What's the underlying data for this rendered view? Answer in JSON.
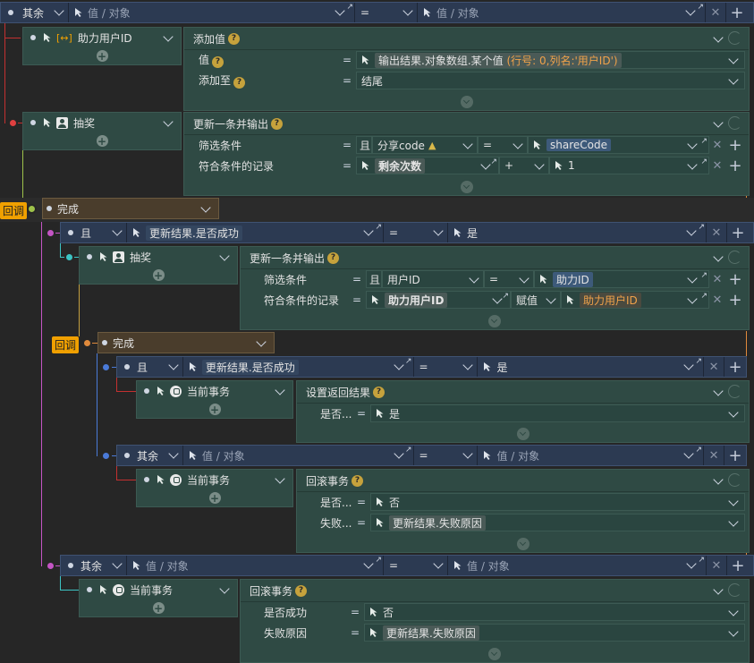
{
  "placeholder_value": "值 / 对象",
  "op_eq": "=",
  "callback": "回调",
  "done": "完成",
  "colors": {
    "cond_bg": "#2c3a52",
    "node_bg": "#2f4a44",
    "done_bg": "#4a3d2c",
    "accent_orange": "#f0a000"
  },
  "b1": {
    "keyword": "其余"
  },
  "n1": {
    "label": "助力用户ID",
    "icon": "variable-icon"
  },
  "p1": {
    "title": "添加值",
    "rows": [
      {
        "label": "值",
        "value_pre": "输出结果.对象数组.某个值",
        "value_hint": "(行号: 0,列名:'用户ID')"
      },
      {
        "label": "添加至",
        "value": "结尾"
      }
    ]
  },
  "n2": {
    "label": "抽奖",
    "icon": "person-icon"
  },
  "p2": {
    "title": "更新一条并输出",
    "rows": [
      {
        "label": "筛选条件",
        "and": "且",
        "field": "分享code",
        "op": "=",
        "value": "shareCode"
      },
      {
        "label": "符合条件的记录",
        "field": "剩余次数",
        "op": "+",
        "value": "1"
      }
    ]
  },
  "b2": {
    "keyword": "且",
    "left": "更新结果.是否成功",
    "right": "是"
  },
  "n3": {
    "label": "抽奖",
    "icon": "person-icon"
  },
  "p3": {
    "title": "更新一条并输出",
    "rows": [
      {
        "label": "筛选条件",
        "and": "且",
        "field": "用户ID",
        "op": "=",
        "value": "助力ID"
      },
      {
        "label": "符合条件的记录",
        "field": "助力用户ID",
        "op": "赋值",
        "value": "助力用户ID"
      }
    ]
  },
  "b3": {
    "keyword": "且",
    "left": "更新结果.是否成功",
    "right": "是"
  },
  "n4": {
    "label": "当前事务",
    "icon": "transaction-icon"
  },
  "p4": {
    "title": "设置返回结果",
    "rows": [
      {
        "label": "是否...",
        "value": "是"
      }
    ]
  },
  "b4": {
    "keyword": "其余"
  },
  "n5": {
    "label": "当前事务",
    "icon": "transaction-icon"
  },
  "p5": {
    "title": "回滚事务",
    "rows": [
      {
        "label": "是否...",
        "value": "否"
      },
      {
        "label": "失败...",
        "value": "更新结果.失败原因"
      }
    ]
  },
  "b5": {
    "keyword": "其余"
  },
  "n6": {
    "label": "当前事务",
    "icon": "transaction-icon"
  },
  "p6": {
    "title": "回滚事务",
    "rows": [
      {
        "label": "是否成功",
        "value": "否"
      },
      {
        "label": "失败原因",
        "value": "更新结果.失败原因"
      }
    ]
  }
}
